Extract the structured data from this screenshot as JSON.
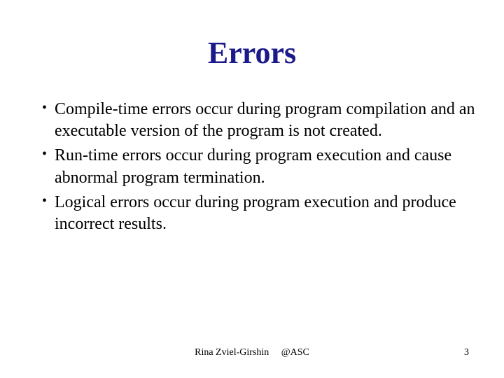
{
  "title": "Errors",
  "bullets": [
    "Compile-time errors occur during program compilation and an executable version of the program is not created.",
    "Run-time errors occur during program execution and cause abnormal program termination.",
    "Logical errors occur during program execution and produce incorrect results."
  ],
  "footer": {
    "author": "Rina Zviel-Girshin",
    "org": "@ASC",
    "page": "3"
  }
}
